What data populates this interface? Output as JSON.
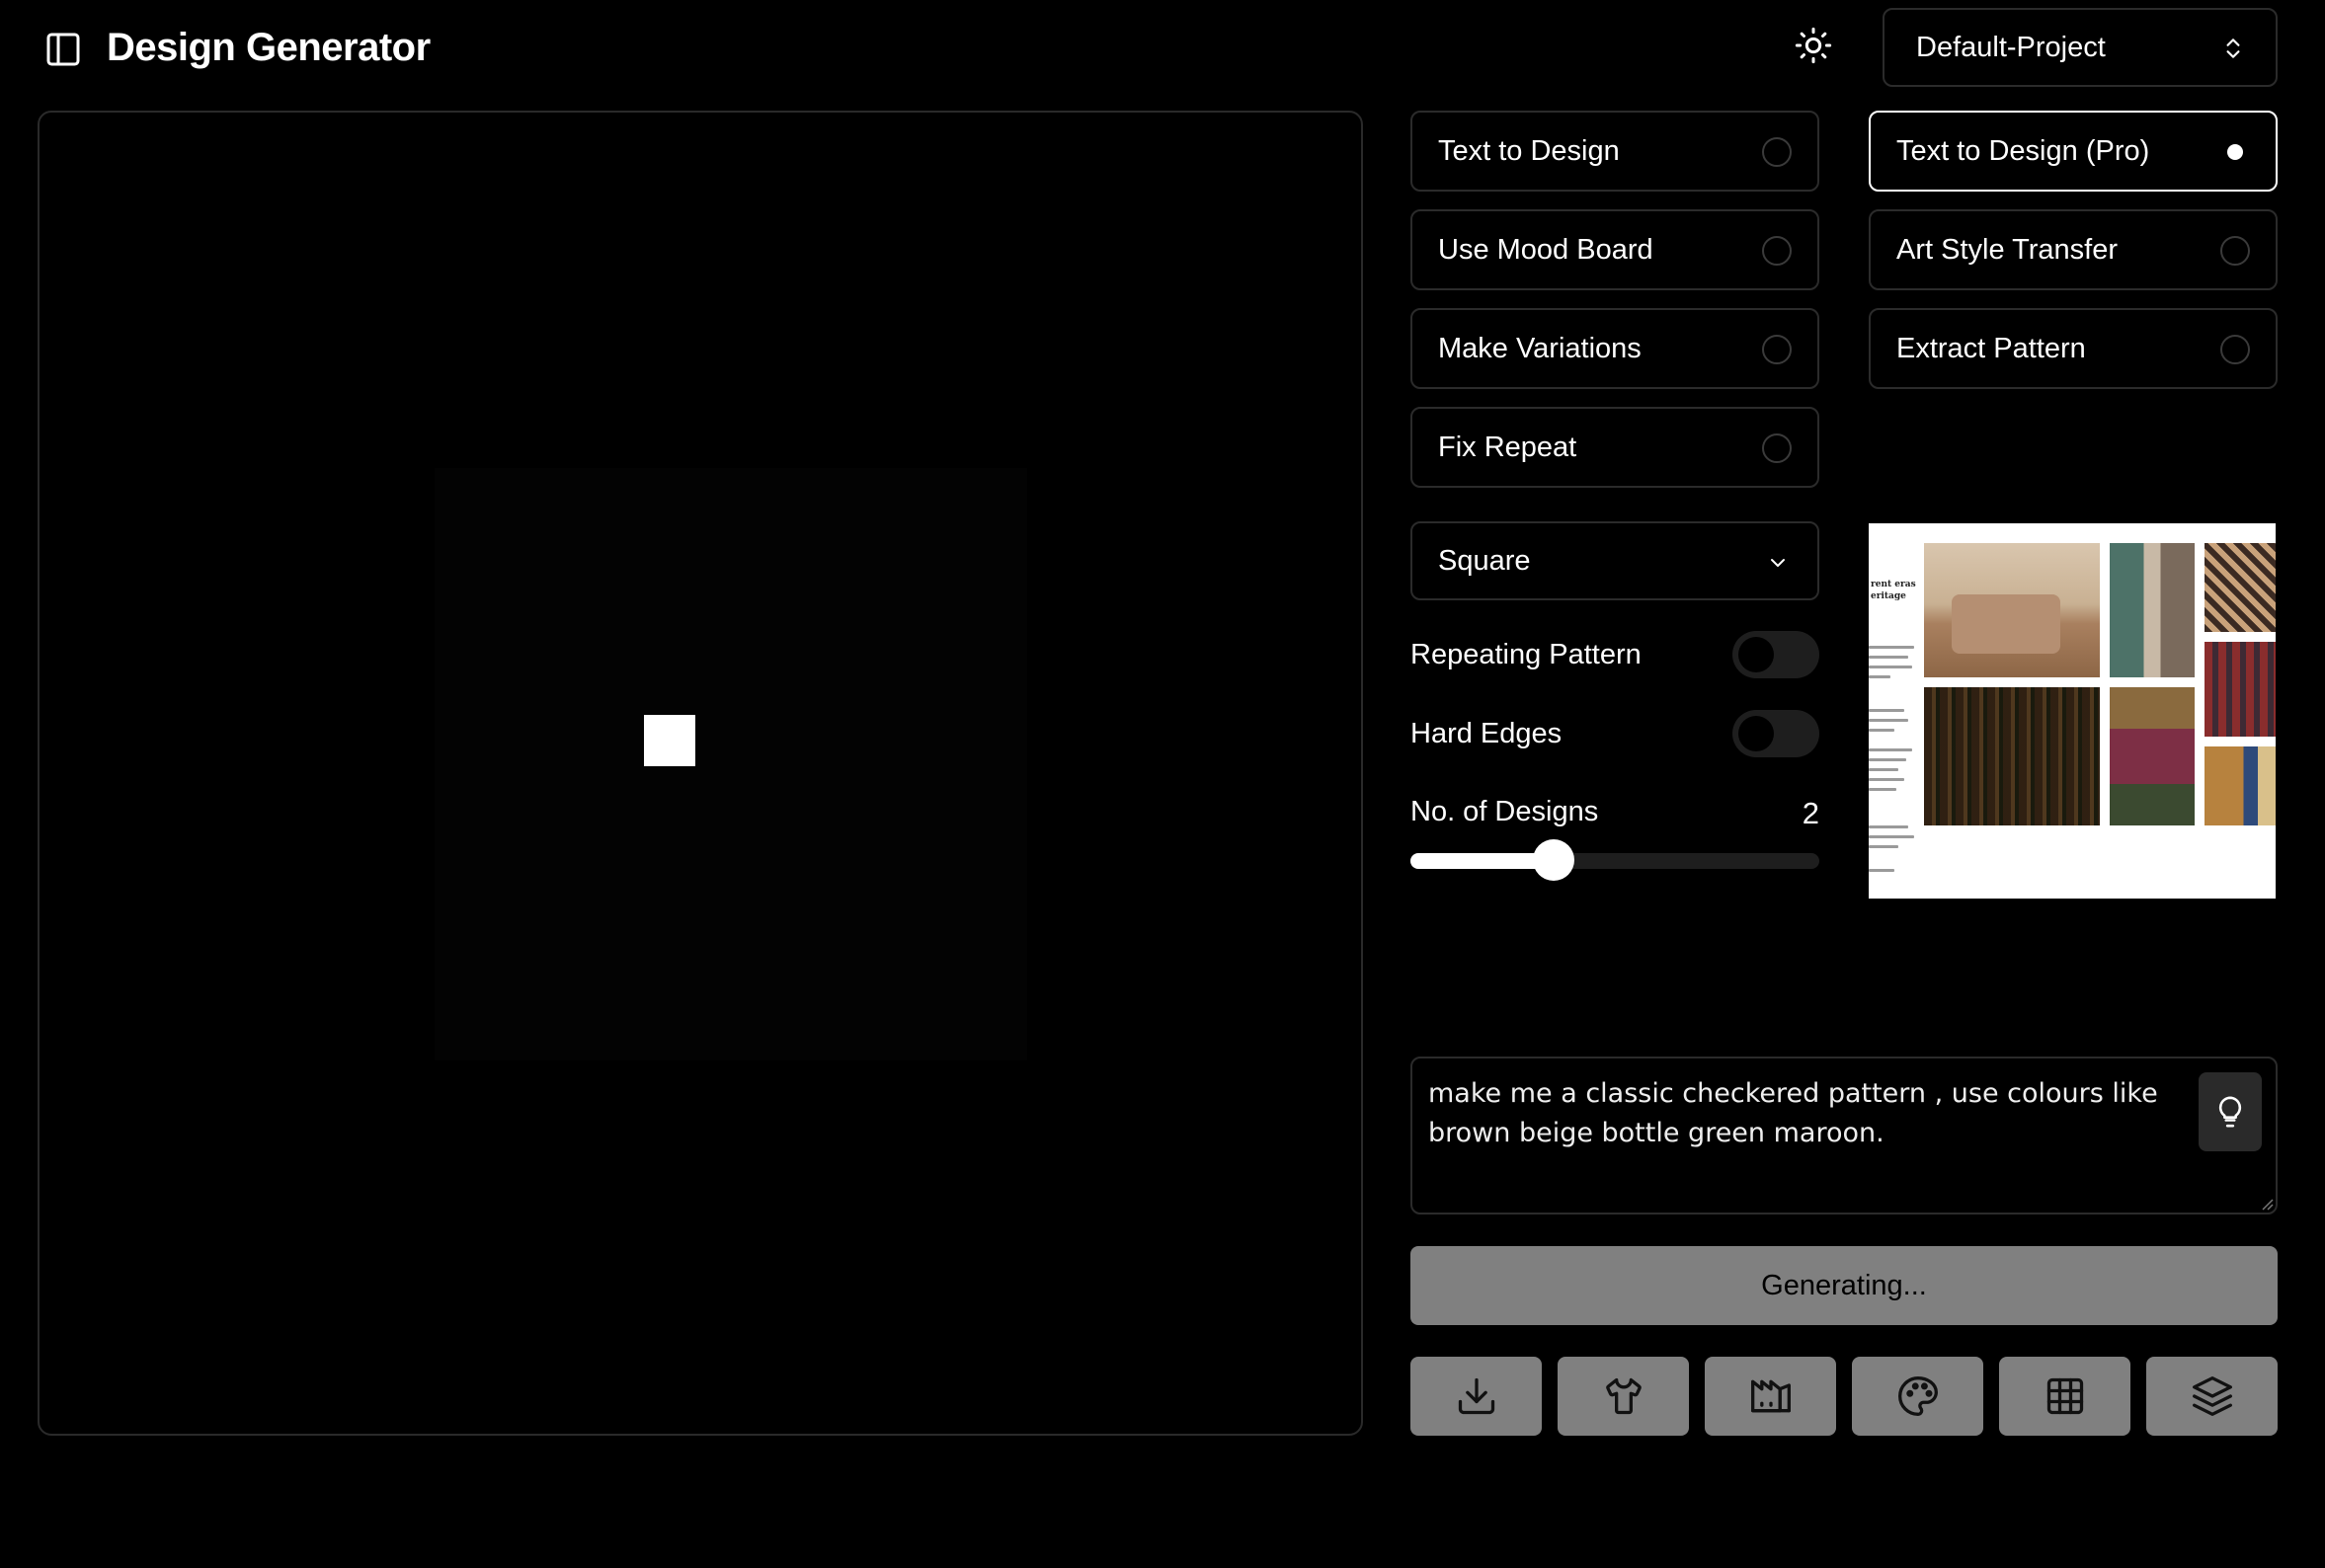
{
  "header": {
    "title": "Design Generator",
    "project": "Default-Project"
  },
  "modes": [
    {
      "label": "Text to Design",
      "selected": false
    },
    {
      "label": "Text to Design (Pro)",
      "selected": true
    },
    {
      "label": "Use Mood Board",
      "selected": false
    },
    {
      "label": "Art Style Transfer",
      "selected": false
    },
    {
      "label": "Make Variations",
      "selected": false
    },
    {
      "label": "Extract Pattern",
      "selected": false
    },
    {
      "label": "Fix Repeat",
      "selected": false
    }
  ],
  "settings": {
    "aspect_ratio": "Square",
    "repeating_pattern_label": "Repeating Pattern",
    "repeating_pattern": false,
    "hard_edges_label": "Hard Edges",
    "hard_edges": false,
    "designs_label": "No. of Designs",
    "designs_value": "2",
    "designs_fraction": 0.35
  },
  "moodboard": {
    "text_lines": [
      "rent eras",
      "eritage"
    ],
    "colors": {
      "sofa": "#b58f72",
      "plaid": "#6e5a44",
      "panel": "#4d7268",
      "stripe_red": "#8a2d2d",
      "stripe_dark": "#3d2a34",
      "pillow": "#7d2f45",
      "chair": "#3b4a30",
      "wood": "#b7823e"
    }
  },
  "prompt": {
    "text": "make me a classic checkered pattern , use colours like brown beige bottle green maroon."
  },
  "generate": {
    "label": "Generating..."
  },
  "toolbar": {
    "icons": [
      "download-icon",
      "shirt-icon",
      "factory-icon",
      "palette-icon",
      "grid-icon",
      "layers-icon"
    ]
  }
}
